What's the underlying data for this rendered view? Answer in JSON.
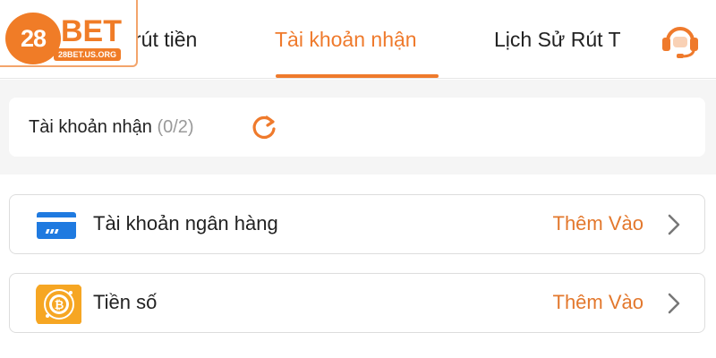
{
  "brand": {
    "logo_number": "28",
    "logo_word": "BET",
    "logo_url": "28BET.US.ORG",
    "accent_color": "#ef7a2c"
  },
  "tabs": [
    {
      "label": "rút tiền",
      "active": false
    },
    {
      "label": "Tài khoản nhận",
      "active": true
    },
    {
      "label": "Lịch Sử Rút T",
      "active": false
    }
  ],
  "header": {
    "support_icon": "headset-icon"
  },
  "receiving_accounts": {
    "title": "Tài khoản nhận",
    "count": "(0/2)",
    "refresh_icon": "refresh-icon"
  },
  "options": [
    {
      "icon": "bank-card-icon",
      "label": "Tài khoản ngân hàng",
      "action": "Thêm Vào"
    },
    {
      "icon": "bitcoin-coin-icon",
      "label": "Tiền số",
      "action": "Thêm Vào"
    }
  ]
}
